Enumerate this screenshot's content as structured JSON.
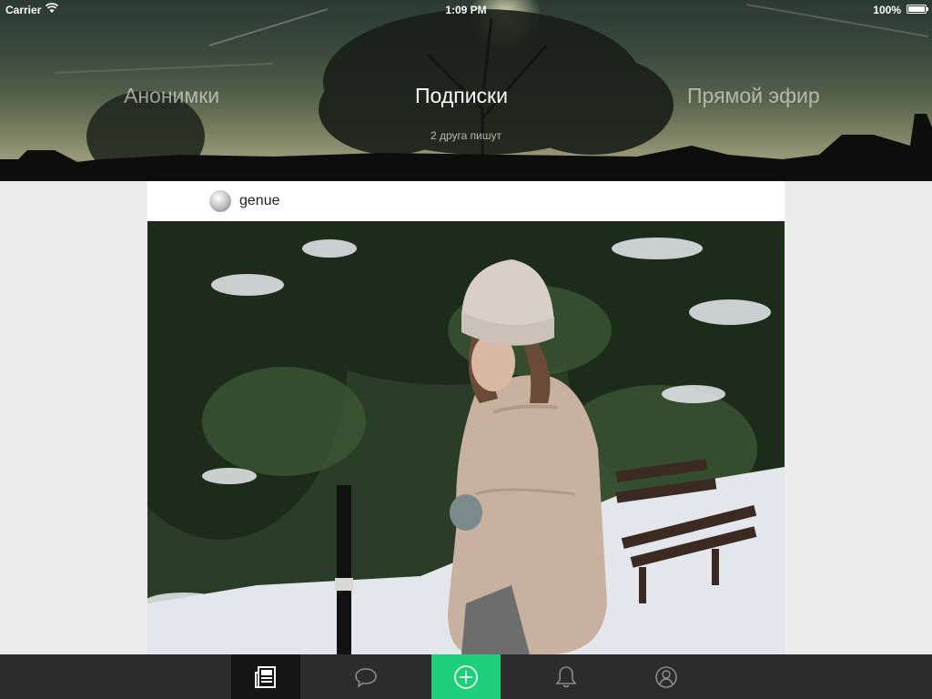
{
  "status_bar": {
    "carrier": "Carrier",
    "time": "1:09 PM",
    "battery": "100%"
  },
  "header": {
    "tabs": [
      {
        "label": "Анонимки",
        "active": false
      },
      {
        "label": "Подписки",
        "active": true
      },
      {
        "label": "Прямой эфир",
        "active": false
      }
    ],
    "subtitle": "2 друга пишут"
  },
  "feed": {
    "posts": [
      {
        "username": "genue"
      }
    ]
  },
  "tab_bar": {
    "items": [
      {
        "icon": "news-feed-icon",
        "selected": true
      },
      {
        "icon": "chat-bubble-icon",
        "selected": false
      },
      {
        "icon": "plus-circle-icon",
        "selected": false,
        "accent": "#1fd07a"
      },
      {
        "icon": "bell-icon",
        "selected": false
      },
      {
        "icon": "profile-icon",
        "selected": false
      }
    ]
  },
  "colors": {
    "accent": "#1fd07a",
    "tab_bar_bg": "#2c2c2c",
    "tab_selected_bg": "#151515",
    "page_bg": "#ececec"
  }
}
